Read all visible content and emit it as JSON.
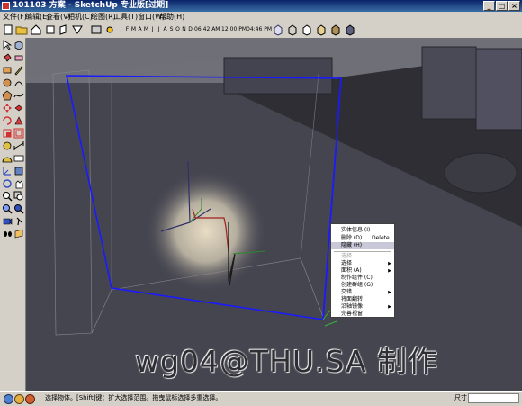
{
  "window": {
    "title": "101103 方案 - SketchUp 专业版[过期]"
  },
  "menubar": [
    "文件(F)",
    "编辑(E)",
    "查看(V)",
    "相机(C)",
    "绘图(R)",
    "工具(T)",
    "窗口(W)",
    "帮助(H)"
  ],
  "toolbar": {
    "months": [
      "J",
      "F",
      "M",
      "A",
      "M",
      "J",
      "J",
      "A",
      "S",
      "O",
      "N",
      "D"
    ],
    "time_start": "06:42 AM",
    "time_noon": "12:00 PM",
    "time_end": "04:46 PM"
  },
  "context_menu": {
    "items": [
      {
        "label": "实体信息 (I)",
        "shortcut": "",
        "submenu": false,
        "disabled": false,
        "highlighted": false
      },
      {
        "label": "删除 (D)",
        "shortcut": "Delete",
        "submenu": false,
        "disabled": false,
        "highlighted": false
      },
      {
        "label": "隐藏 (H)",
        "shortcut": "",
        "submenu": false,
        "disabled": false,
        "highlighted": true
      },
      {
        "label": "选择",
        "shortcut": "",
        "submenu": false,
        "disabled": true,
        "highlighted": false
      },
      {
        "label": "选择",
        "shortcut": "",
        "submenu": true,
        "disabled": false,
        "highlighted": false
      },
      {
        "label": "面积 (A)",
        "shortcut": "",
        "submenu": true,
        "disabled": false,
        "highlighted": false
      },
      {
        "label": "制作组件 (C)",
        "shortcut": "",
        "submenu": false,
        "disabled": false,
        "highlighted": false
      },
      {
        "label": "创建群组 (G)",
        "shortcut": "",
        "submenu": false,
        "disabled": false,
        "highlighted": false
      },
      {
        "label": "交错",
        "shortcut": "",
        "submenu": true,
        "disabled": false,
        "highlighted": false
      },
      {
        "label": "将面翻转",
        "shortcut": "",
        "submenu": false,
        "disabled": false,
        "highlighted": false
      },
      {
        "label": "沿轴镜像",
        "shortcut": "",
        "submenu": true,
        "disabled": false,
        "highlighted": false
      },
      {
        "label": "完善视窗",
        "shortcut": "",
        "submenu": false,
        "disabled": false,
        "highlighted": false
      }
    ]
  },
  "watermark": "wg04@THU.SA 制作",
  "status": {
    "hint": "选择物体。[Shift]键：扩大选择范围。拖曳鼠标选择多重选择。",
    "measure_label": "尺寸",
    "measure_value": ""
  },
  "colors": {
    "title_bar": "#0a246a",
    "viewport_bg": "#454550",
    "selection_box": "#1a1aff",
    "menu_highlight": "#c8c8d8"
  }
}
